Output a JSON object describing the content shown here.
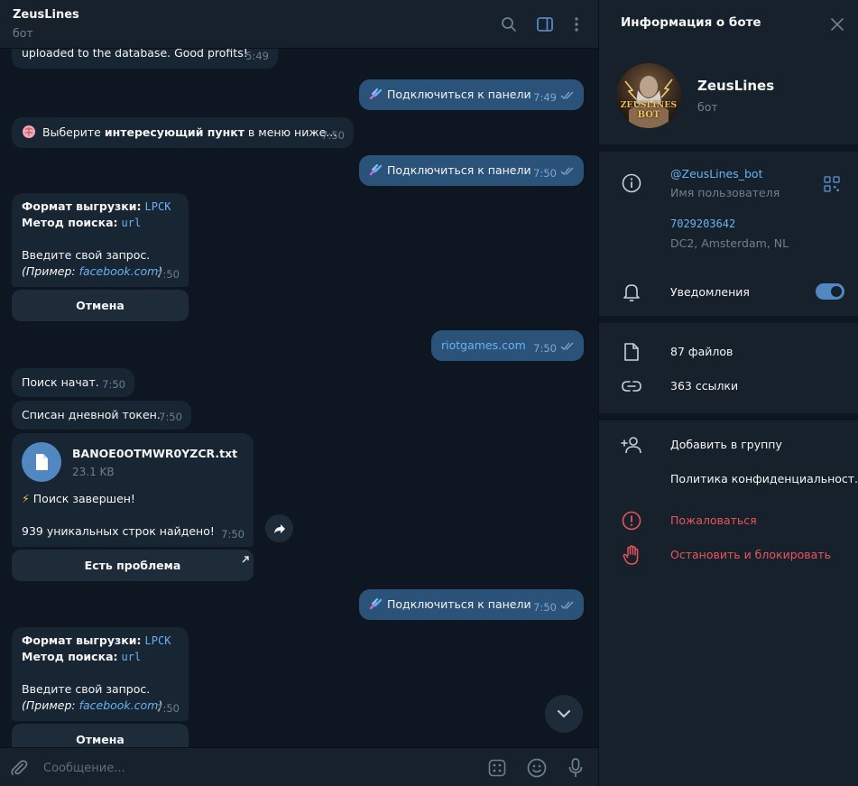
{
  "chat": {
    "title": "ZeusLines",
    "status": "бот"
  },
  "messages": {
    "m0": {
      "text": "uploaded to the database. Good profits!",
      "time": "5:49"
    },
    "m1": {
      "text": "Подключиться к панели",
      "time": "7:49"
    },
    "m2": {
      "pre": "Выберите ",
      "bold": "интересующий пункт",
      "post": " в меню ниже...",
      "time": "7:50"
    },
    "m3": {
      "text": "Подключиться к панели",
      "time": "7:50"
    },
    "m4": {
      "format_label": "Формат выгрузки:",
      "format_value": "LPCK",
      "method_label": "Метод поиска:",
      "method_value": "url",
      "prompt": "Введите свой запрос.",
      "example_pre": "(Пример: ",
      "example_link": "facebook.com",
      "example_post": ")",
      "time": "7:50",
      "button": "Отмена"
    },
    "m5": {
      "text": "riotgames.com",
      "time": "7:50"
    },
    "m6": {
      "text": "Поиск начат.",
      "time": "7:50"
    },
    "m7": {
      "text": "Списан дневной токен.",
      "time": "7:50"
    },
    "m8": {
      "file_name": "BANOE0OTMWR0YZCR.txt",
      "file_size": "23.1 KB",
      "line1_emoji": "⚡",
      "line1": "Поиск завершен!",
      "line2": "939 уникальных строк найдено!",
      "time": "7:50",
      "button": "Есть проблема"
    },
    "m9": {
      "text": "Подключиться к панели",
      "time": "7:50"
    },
    "m10": {
      "format_label": "Формат выгрузки:",
      "format_value": "LPCK",
      "method_label": "Метод поиска:",
      "method_value": "url",
      "prompt": "Введите свой запрос.",
      "example_pre": "(Пример: ",
      "example_link": "facebook.com",
      "example_post": ")",
      "time": "7:50",
      "button": "Отмена"
    }
  },
  "input": {
    "placeholder": "Сообщение..."
  },
  "info": {
    "title": "Информация о боте",
    "bot_name": "ZeusLines",
    "bot_sub": "бот",
    "avatar_text": "ZEUSLINES",
    "avatar_text2": "BOT",
    "username": "@ZeusLines_bot",
    "username_label": "Имя пользователя",
    "id": "7029203642",
    "dc": "DC2, Amsterdam, NL",
    "notifications": "Уведомления",
    "notifications_on": true,
    "files": "87 файлов",
    "links": "363 ссылки",
    "add_to_group": "Добавить в группу",
    "privacy": "Политика конфиденциальност...",
    "report": "Пожаловаться",
    "block": "Остановить и блокировать"
  },
  "colors": {
    "bg": "#0e1621",
    "panel": "#17212b",
    "bubble_in": "#182533",
    "bubble_out": "#2b5278",
    "accent": "#6ab2f2",
    "danger": "#e9545a"
  }
}
